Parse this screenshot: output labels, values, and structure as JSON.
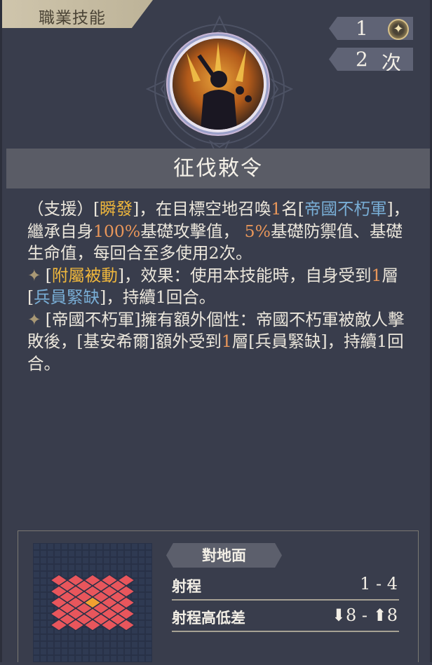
{
  "header": {
    "tab_label": "職業技能"
  },
  "counters": {
    "cost": "1",
    "uses": "2",
    "uses_unit": "次",
    "cost_icon": "star-icon"
  },
  "skill": {
    "name": "征伐敕令"
  },
  "description": {
    "p1": [
      {
        "t": "（支援）[",
        "c": ""
      },
      {
        "t": "瞬發",
        "c": "gold"
      },
      {
        "t": "]，在目標空地召喚",
        "c": ""
      },
      {
        "t": "1",
        "c": "orange"
      },
      {
        "t": "名[",
        "c": ""
      },
      {
        "t": "帝國不朽軍",
        "c": "blue"
      },
      {
        "t": "]，繼承自身",
        "c": ""
      },
      {
        "t": "100%",
        "c": "orange"
      },
      {
        "t": "基礎攻擊值， ",
        "c": ""
      },
      {
        "t": "5%",
        "c": "orange"
      },
      {
        "t": "基礎防禦值、基礎生命值，每回合至多使用2次。",
        "c": ""
      }
    ],
    "p2": [
      {
        "t": "[",
        "c": ""
      },
      {
        "t": "附屬被動",
        "c": "gold"
      },
      {
        "t": "]，效果：使用本技能時，自身受到",
        "c": ""
      },
      {
        "t": "1",
        "c": "orange"
      },
      {
        "t": "層[",
        "c": ""
      },
      {
        "t": "兵員緊缺",
        "c": "blue"
      },
      {
        "t": "]，持續1回合。",
        "c": ""
      }
    ],
    "p3": [
      {
        "t": "[帝國不朽軍]擁有額外個性：帝國不朽軍被敵人擊敗後，[基安希爾]額外受到",
        "c": ""
      },
      {
        "t": "1",
        "c": "orange"
      },
      {
        "t": "層[兵員緊缺]，持續1回合。",
        "c": ""
      }
    ]
  },
  "range_panel": {
    "tag": "對地面",
    "range_label": "射程",
    "range_value": "1 - 4",
    "height_label": "射程高低差",
    "height_value": "⬇8 - ⬆8"
  }
}
